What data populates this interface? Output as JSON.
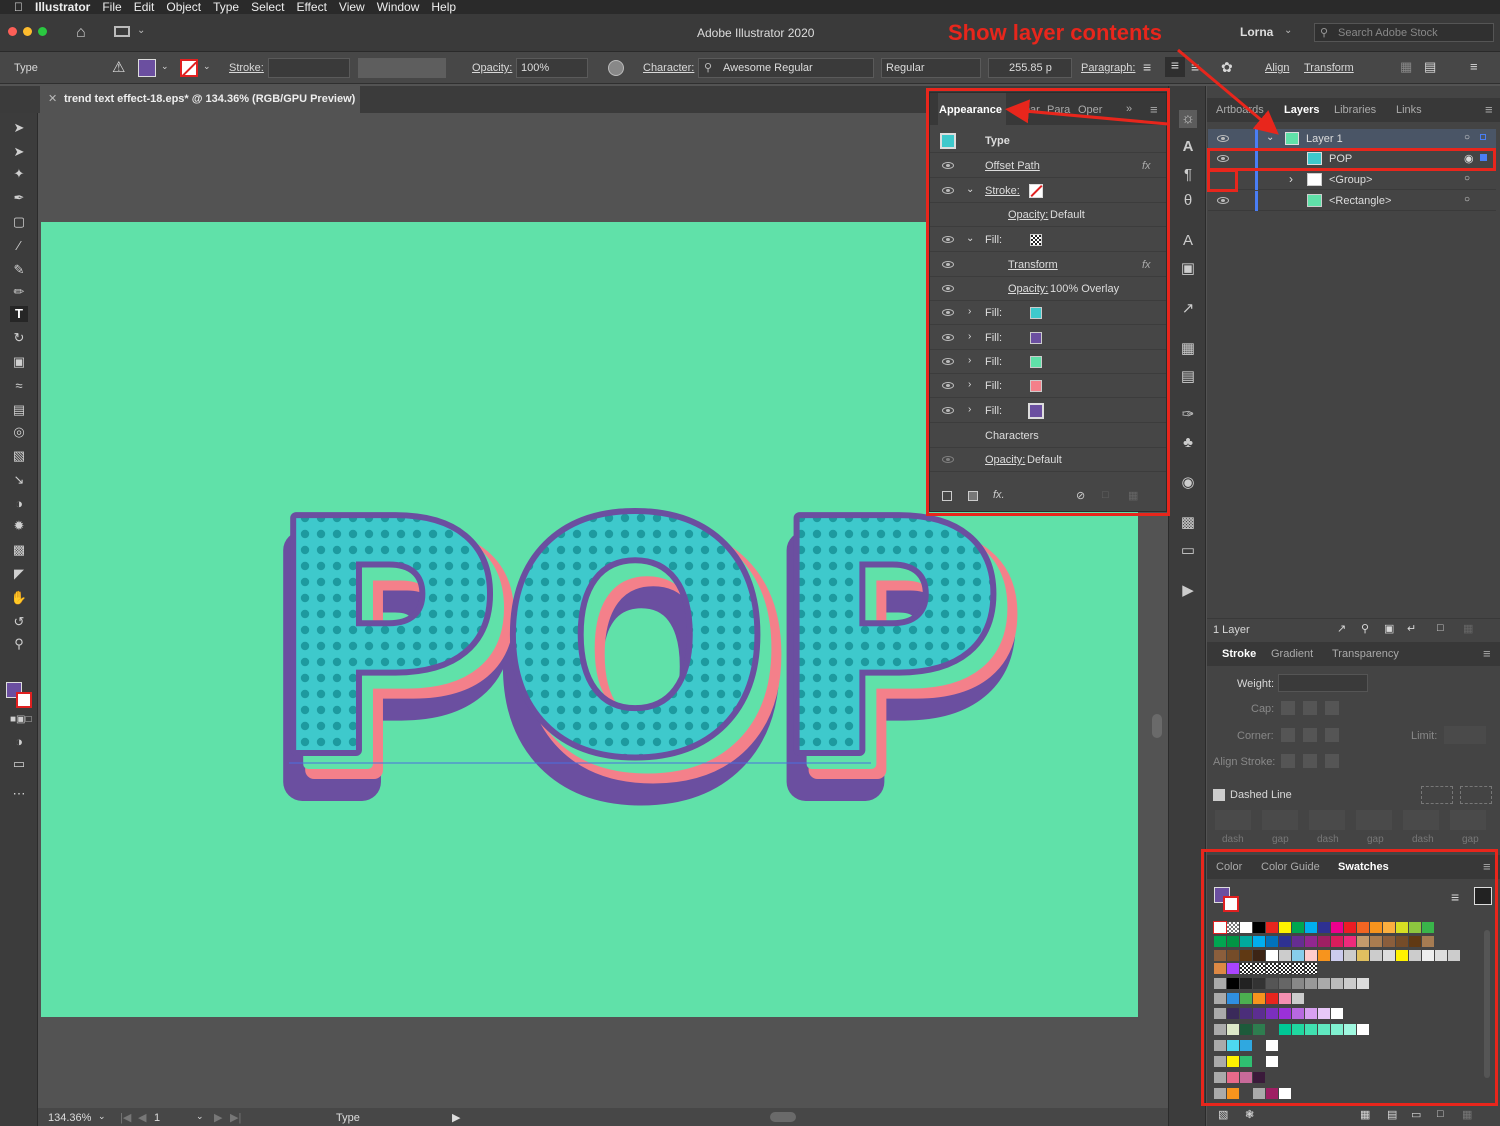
{
  "menubar": {
    "app_name": "Illustrator",
    "items": [
      "File",
      "Edit",
      "Object",
      "Type",
      "Select",
      "Effect",
      "View",
      "Window",
      "Help"
    ]
  },
  "titlebar": {
    "title": "Adobe Illustrator 2020",
    "user": "Lorna",
    "search_placeholder": "Search Adobe Stock"
  },
  "annotation": {
    "text": "Show layer contents",
    "color": "#e8261c"
  },
  "control_bar": {
    "mode": "Type",
    "stroke_label": "Stroke:",
    "opacity_label": "Opacity:",
    "opacity_value": "100%",
    "character_label": "Character:",
    "font_family": "Awesome Regular",
    "font_style": "Regular",
    "font_size": "255.85 p",
    "paragraph_label": "Paragraph:",
    "align_label": "Align",
    "transform_label": "Transform",
    "fill_color": "#6b4fa0"
  },
  "document": {
    "tab_title": "trend text effect-18.eps* @ 134.36% (RGB/GPU Preview)",
    "artboard_color": "#60e1a9",
    "art_text": "POP",
    "zoom": "134.36%",
    "page": "1",
    "status_tool": "Type"
  },
  "appearance_panel": {
    "tabs": [
      "Appearance",
      "Char",
      "Para",
      "Oper"
    ],
    "header_label": "Type",
    "rows": [
      {
        "label": "Offset Path",
        "fx": "fx"
      },
      {
        "label": "Stroke:"
      },
      {
        "label": "Opacity:",
        "value": "Default"
      },
      {
        "label": "Fill:"
      },
      {
        "label": "Transform",
        "fx": "fx"
      },
      {
        "label": "Opacity:",
        "value": "100% Overlay"
      },
      {
        "label": "Fill:",
        "swatch": "#3ec9cc"
      },
      {
        "label": "Fill:",
        "swatch": "#6b4fa0"
      },
      {
        "label": "Fill:",
        "swatch": "#60e1a9"
      },
      {
        "label": "Fill:",
        "swatch": "#f4808a"
      },
      {
        "label": "Fill:",
        "swatch": "#6b4fa0"
      },
      {
        "label": "Characters"
      },
      {
        "label": "Opacity:",
        "value": "Default"
      }
    ]
  },
  "layers_panel": {
    "tabs": [
      "Artboards",
      "Layers",
      "Libraries",
      "Links"
    ],
    "items": [
      {
        "name": "Layer 1"
      },
      {
        "name": "POP"
      },
      {
        "name": "<Group>"
      },
      {
        "name": "<Rectangle>"
      }
    ],
    "footer": "1 Layer"
  },
  "stroke_panel": {
    "tabs": [
      "Stroke",
      "Gradient",
      "Transparency"
    ],
    "weight_label": "Weight:",
    "cap_label": "Cap:",
    "corner_label": "Corner:",
    "limit_label": "Limit:",
    "align_label": "Align Stroke:",
    "dashed_label": "Dashed Line",
    "dash_labels": [
      "dash",
      "gap",
      "dash",
      "gap",
      "dash",
      "gap"
    ]
  },
  "swatches_panel": {
    "tabs": [
      "Color",
      "Color Guide",
      "Swatches"
    ]
  }
}
